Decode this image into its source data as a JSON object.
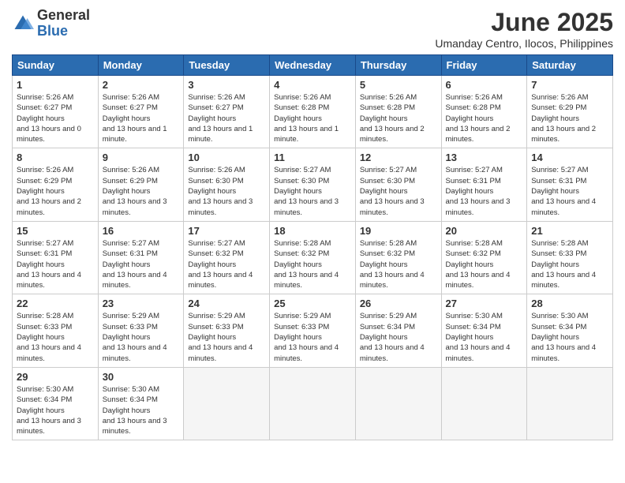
{
  "logo": {
    "general": "General",
    "blue": "Blue"
  },
  "title": "June 2025",
  "location": "Umanday Centro, Ilocos, Philippines",
  "headers": [
    "Sunday",
    "Monday",
    "Tuesday",
    "Wednesday",
    "Thursday",
    "Friday",
    "Saturday"
  ],
  "weeks": [
    [
      {
        "day": 1,
        "sunrise": "5:26 AM",
        "sunset": "6:27 PM",
        "daylight": "13 hours and 0 minutes."
      },
      {
        "day": 2,
        "sunrise": "5:26 AM",
        "sunset": "6:27 PM",
        "daylight": "13 hours and 1 minute."
      },
      {
        "day": 3,
        "sunrise": "5:26 AM",
        "sunset": "6:27 PM",
        "daylight": "13 hours and 1 minute."
      },
      {
        "day": 4,
        "sunrise": "5:26 AM",
        "sunset": "6:28 PM",
        "daylight": "13 hours and 1 minute."
      },
      {
        "day": 5,
        "sunrise": "5:26 AM",
        "sunset": "6:28 PM",
        "daylight": "13 hours and 2 minutes."
      },
      {
        "day": 6,
        "sunrise": "5:26 AM",
        "sunset": "6:28 PM",
        "daylight": "13 hours and 2 minutes."
      },
      {
        "day": 7,
        "sunrise": "5:26 AM",
        "sunset": "6:29 PM",
        "daylight": "13 hours and 2 minutes."
      }
    ],
    [
      {
        "day": 8,
        "sunrise": "5:26 AM",
        "sunset": "6:29 PM",
        "daylight": "13 hours and 2 minutes."
      },
      {
        "day": 9,
        "sunrise": "5:26 AM",
        "sunset": "6:29 PM",
        "daylight": "13 hours and 3 minutes."
      },
      {
        "day": 10,
        "sunrise": "5:26 AM",
        "sunset": "6:30 PM",
        "daylight": "13 hours and 3 minutes."
      },
      {
        "day": 11,
        "sunrise": "5:27 AM",
        "sunset": "6:30 PM",
        "daylight": "13 hours and 3 minutes."
      },
      {
        "day": 12,
        "sunrise": "5:27 AM",
        "sunset": "6:30 PM",
        "daylight": "13 hours and 3 minutes."
      },
      {
        "day": 13,
        "sunrise": "5:27 AM",
        "sunset": "6:31 PM",
        "daylight": "13 hours and 3 minutes."
      },
      {
        "day": 14,
        "sunrise": "5:27 AM",
        "sunset": "6:31 PM",
        "daylight": "13 hours and 4 minutes."
      }
    ],
    [
      {
        "day": 15,
        "sunrise": "5:27 AM",
        "sunset": "6:31 PM",
        "daylight": "13 hours and 4 minutes."
      },
      {
        "day": 16,
        "sunrise": "5:27 AM",
        "sunset": "6:31 PM",
        "daylight": "13 hours and 4 minutes."
      },
      {
        "day": 17,
        "sunrise": "5:27 AM",
        "sunset": "6:32 PM",
        "daylight": "13 hours and 4 minutes."
      },
      {
        "day": 18,
        "sunrise": "5:28 AM",
        "sunset": "6:32 PM",
        "daylight": "13 hours and 4 minutes."
      },
      {
        "day": 19,
        "sunrise": "5:28 AM",
        "sunset": "6:32 PM",
        "daylight": "13 hours and 4 minutes."
      },
      {
        "day": 20,
        "sunrise": "5:28 AM",
        "sunset": "6:32 PM",
        "daylight": "13 hours and 4 minutes."
      },
      {
        "day": 21,
        "sunrise": "5:28 AM",
        "sunset": "6:33 PM",
        "daylight": "13 hours and 4 minutes."
      }
    ],
    [
      {
        "day": 22,
        "sunrise": "5:28 AM",
        "sunset": "6:33 PM",
        "daylight": "13 hours and 4 minutes."
      },
      {
        "day": 23,
        "sunrise": "5:29 AM",
        "sunset": "6:33 PM",
        "daylight": "13 hours and 4 minutes."
      },
      {
        "day": 24,
        "sunrise": "5:29 AM",
        "sunset": "6:33 PM",
        "daylight": "13 hours and 4 minutes."
      },
      {
        "day": 25,
        "sunrise": "5:29 AM",
        "sunset": "6:33 PM",
        "daylight": "13 hours and 4 minutes."
      },
      {
        "day": 26,
        "sunrise": "5:29 AM",
        "sunset": "6:34 PM",
        "daylight": "13 hours and 4 minutes."
      },
      {
        "day": 27,
        "sunrise": "5:30 AM",
        "sunset": "6:34 PM",
        "daylight": "13 hours and 4 minutes."
      },
      {
        "day": 28,
        "sunrise": "5:30 AM",
        "sunset": "6:34 PM",
        "daylight": "13 hours and 4 minutes."
      }
    ],
    [
      {
        "day": 29,
        "sunrise": "5:30 AM",
        "sunset": "6:34 PM",
        "daylight": "13 hours and 3 minutes."
      },
      {
        "day": 30,
        "sunrise": "5:30 AM",
        "sunset": "6:34 PM",
        "daylight": "13 hours and 3 minutes."
      },
      null,
      null,
      null,
      null,
      null
    ]
  ]
}
